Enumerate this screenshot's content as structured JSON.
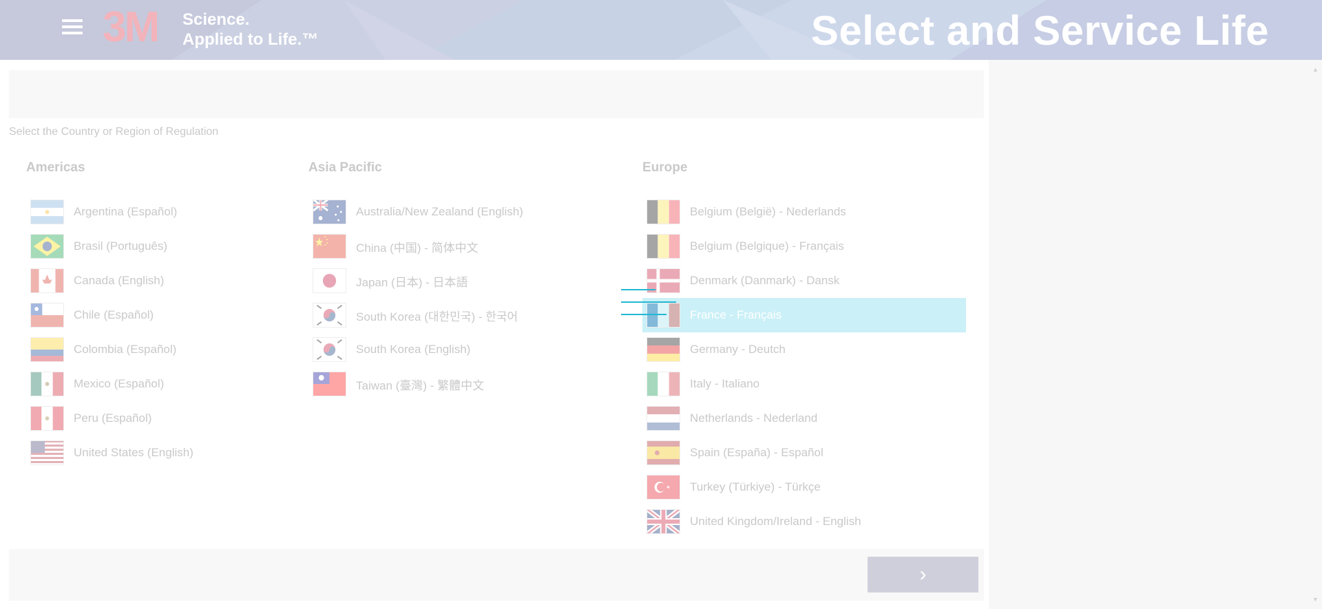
{
  "header": {
    "menu_icon": "hamburger-menu-icon",
    "logo_text": "3M",
    "tagline_line1": "Science.",
    "tagline_line2": "Applied to Life.™",
    "title": "Select and Service Life"
  },
  "prompt": "Select the Country or Region of Regulation",
  "regions": [
    {
      "title": "Americas",
      "countries": [
        {
          "label": "Argentina (Español)",
          "flag": "argentina-flag-icon"
        },
        {
          "label": "Brasil (Português)",
          "flag": "brazil-flag-icon"
        },
        {
          "label": "Canada (English)",
          "flag": "canada-flag-icon"
        },
        {
          "label": "Chile (Español)",
          "flag": "chile-flag-icon"
        },
        {
          "label": "Colombia (Español)",
          "flag": "colombia-flag-icon"
        },
        {
          "label": "Mexico (Español)",
          "flag": "mexico-flag-icon"
        },
        {
          "label": "Peru (Español)",
          "flag": "peru-flag-icon"
        },
        {
          "label": "United States (English)",
          "flag": "usa-flag-icon"
        }
      ]
    },
    {
      "title": "Asia Pacific",
      "countries": [
        {
          "label": "Australia/New Zealand (English)",
          "flag": "australia-flag-icon"
        },
        {
          "label": "China (中国) - 简体中文",
          "flag": "china-flag-icon"
        },
        {
          "label": "Japan (日本) - 日本語",
          "flag": "japan-flag-icon"
        },
        {
          "label": "South Korea (대한민국) - 한국어",
          "flag": "south-korea-flag-icon"
        },
        {
          "label": "South Korea (English)",
          "flag": "south-korea-flag-icon"
        },
        {
          "label": "Taiwan (臺灣) - 繁體中文",
          "flag": "taiwan-flag-icon"
        }
      ]
    },
    {
      "title": "Europe",
      "countries": [
        {
          "label": "Belgium (België) - Nederlands",
          "flag": "belgium-flag-icon"
        },
        {
          "label": "Belgium (Belgique) - Français",
          "flag": "belgium-flag-icon"
        },
        {
          "label": "Denmark (Danmark) - Dansk",
          "flag": "denmark-flag-icon"
        },
        {
          "label": "France - Français",
          "flag": "france-flag-icon",
          "selected": true
        },
        {
          "label": "Germany - Deutch",
          "flag": "germany-flag-icon"
        },
        {
          "label": "Italy - Italiano",
          "flag": "italy-flag-icon"
        },
        {
          "label": "Netherlands - Nederland",
          "flag": "netherlands-flag-icon"
        },
        {
          "label": "Spain (España) - Español",
          "flag": "spain-flag-icon"
        },
        {
          "label": "Turkey (Türkiye) - Türkçe",
          "flag": "turkey-flag-icon"
        },
        {
          "label": "United Kingdom/Ireland - English",
          "flag": "uk-flag-icon"
        }
      ]
    }
  ],
  "footer": {
    "next_icon": "chevron-right-icon",
    "next_glyph": "›"
  },
  "colors": {
    "selected_row": "#cbf0f7",
    "next_button": "#cfcfdc",
    "logo": "#f2b3ba"
  }
}
